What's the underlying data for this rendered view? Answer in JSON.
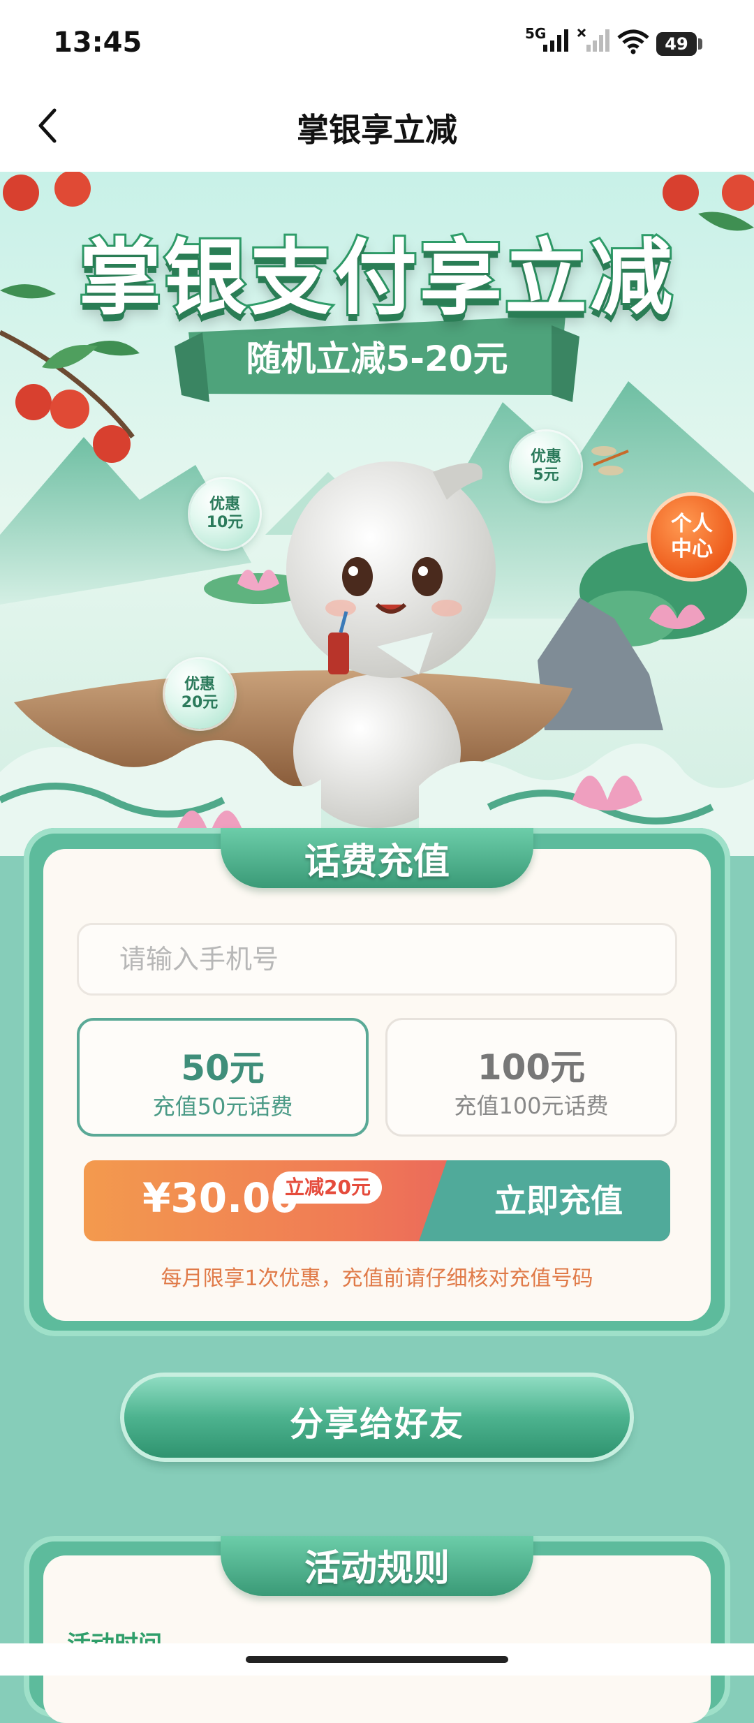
{
  "status_bar": {
    "time": "13:45",
    "network": "5G",
    "battery": "49"
  },
  "nav": {
    "title": "掌银享立减"
  },
  "hero": {
    "title": "掌银支付享立减",
    "subtitle": "随机立减5-20元",
    "bubbles": [
      {
        "line1": "优惠",
        "line2": "10元"
      },
      {
        "line1": "优惠",
        "line2": "5元"
      },
      {
        "line1": "优惠",
        "line2": "20元"
      }
    ],
    "personal_center": {
      "line1": "个人",
      "line2": "中心"
    }
  },
  "recharge": {
    "header": "话费充值",
    "phone_placeholder": "请输入手机号",
    "phone_value": "",
    "options": [
      {
        "amount": "50元",
        "desc": "充值50元话费",
        "selected": true
      },
      {
        "amount": "100元",
        "desc": "充值100元话费",
        "selected": false
      }
    ],
    "price": "¥30.00",
    "discount_tag": "立减20元",
    "pay_button": "立即充值",
    "notice": "每月限享1次优惠，充值前请仔细核对充值号码"
  },
  "share_button": "分享给好友",
  "rules": {
    "header": "活动规则",
    "first_section": "活动时间"
  },
  "colors": {
    "primary_green": "#3a9a77",
    "page_bg": "#86cdb9",
    "orange": "#f39a4e",
    "teal_button": "#50aa9a"
  }
}
